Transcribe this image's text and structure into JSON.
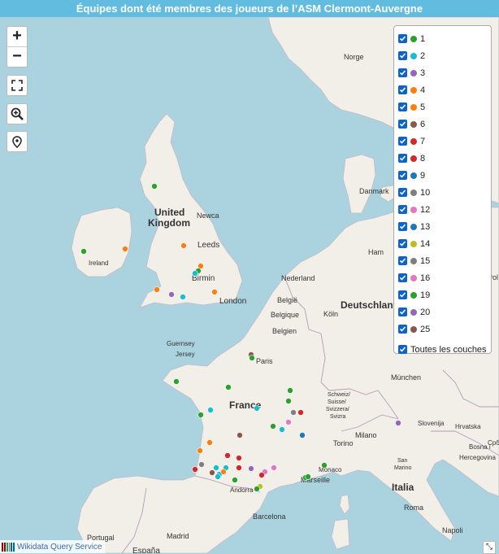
{
  "title": "Équipes dont été membres des joueurs de l’ASM Clermont-Auvergne",
  "controls": {
    "zoom_in": "+",
    "zoom_out": "−",
    "fullscreen_icon": "fullscreen-icon",
    "zoom_area_icon": "zoom-magnifier-icon",
    "locate_icon": "map-marker-icon"
  },
  "layers": [
    {
      "label": "1",
      "color": "#2ca02c"
    },
    {
      "label": "2",
      "color": "#17becf"
    },
    {
      "label": "3",
      "color": "#9467bd"
    },
    {
      "label": "4",
      "color": "#ff7f0e"
    },
    {
      "label": "5",
      "color": "#ff7f0e"
    },
    {
      "label": "6",
      "color": "#8c564b"
    },
    {
      "label": "7",
      "color": "#d62728"
    },
    {
      "label": "8",
      "color": "#d62728"
    },
    {
      "label": "9",
      "color": "#1f77b4"
    },
    {
      "label": "10",
      "color": "#7f7f7f"
    },
    {
      "label": "12",
      "color": "#e377c2"
    },
    {
      "label": "13",
      "color": "#1f77b4"
    },
    {
      "label": "14",
      "color": "#bcbd22"
    },
    {
      "label": "15",
      "color": "#7f7f7f"
    },
    {
      "label": "16",
      "color": "#e377c2"
    },
    {
      "label": "19",
      "color": "#2ca02c"
    },
    {
      "label": "20",
      "color": "#9467bd"
    },
    {
      "label": "25",
      "color": "#8c564b"
    }
  ],
  "all_layers_label": "Toutes les couches",
  "attribution": "Wikidata Query Service",
  "resize_icon": "expand-arrow-icon",
  "places": {
    "norge": "Norge",
    "danmark": "Danmark",
    "uk1": "United",
    "uk2": "Kingdom",
    "newcastle": "Newca",
    "leeds": "Leeds",
    "birmingham": "Birmin",
    "london": "London",
    "ireland": "Ireland",
    "guernsey": "Guernsey",
    "jersey": "Jersey",
    "nederland": "Nederland",
    "belgie": "België",
    "belgique": "Belgique",
    "belgien": "Belgien",
    "deutschland": "Deutschlan",
    "koln": "Köln",
    "ham": "Ham",
    "paris": "Paris",
    "france": "France",
    "munchen": "München",
    "schweiz": "Schweiz/",
    "suisse": "Suisse/",
    "svizzera": "Svizzera/",
    "svizra": "Svizra",
    "milano": "Milano",
    "torino": "Torino",
    "slovenija": "Slovenija",
    "hrvatska": "Hrvatska",
    "bosna": "Bosna i",
    "herceg": "Hercegovina",
    "srbija": "Срби",
    "sanmarino": "San",
    "sanmarino2": "Marino",
    "monaco": "Monaco",
    "marseille": "Marseille",
    "andorra": "Andorra",
    "barcelona": "Barcelona",
    "italia": "Italia",
    "roma": "Roma",
    "napoli": "Napoli",
    "portugal": "Portugal",
    "madrid": "Madrid",
    "espana": "España",
    "pol": "Pol"
  }
}
